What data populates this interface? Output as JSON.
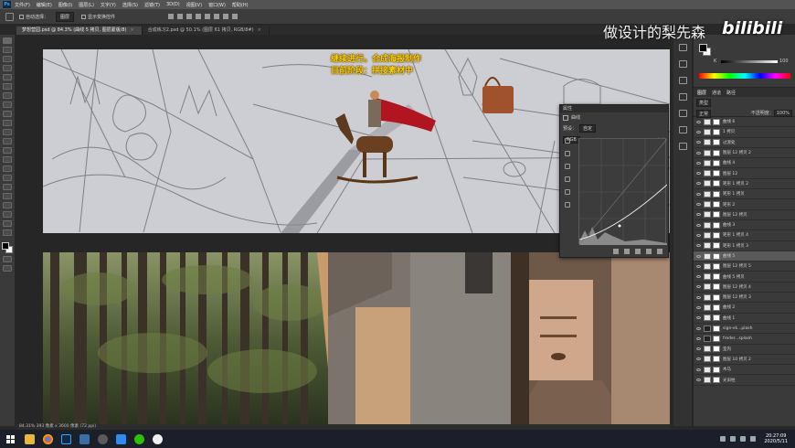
{
  "menubar": {
    "items": [
      "文件(F)",
      "编辑(E)",
      "图像(I)",
      "图层(L)",
      "文字(Y)",
      "选择(S)",
      "滤镜(T)",
      "3D(D)",
      "视图(V)",
      "窗口(W)",
      "帮助(H)"
    ]
  },
  "options": {
    "auto_select_label": "自动选择：",
    "auto_select_value": "图层",
    "transform_label": "显示变换控件"
  },
  "tabs": [
    {
      "label": "梦想营园.psd @ 84.3% (曲线 5 拷贝, 图层蒙版/8)"
    },
    {
      "label": "合成练习2.psd @ 50.1% (图层 61 拷贝, RGB/8#)"
    }
  ],
  "captions": {
    "line1": "继续进行。合成海报制作",
    "line2": "目前阶段：拼接素材中"
  },
  "watermark": {
    "text": "做设计的梨先森",
    "logo": "bilibili"
  },
  "properties": {
    "title": "属性",
    "type": "曲线",
    "preset_label": "预设：",
    "preset_value": "自定",
    "channel_value": "RGB",
    "auto_label": "自动"
  },
  "color_panel": {
    "k_label": "K",
    "k_value": "100"
  },
  "layers": {
    "tabs": [
      "图层",
      "通道",
      "路径"
    ],
    "kind_label": "类型",
    "blend_mode": "正常",
    "opacity_label": "不透明度：",
    "opacity_value": "100%",
    "lock_label": "锁定：",
    "fill_label": "填充：",
    "fill_value": "100%",
    "rows": [
      {
        "name": "曲线 6"
      },
      {
        "name": "1 拷贝"
      },
      {
        "name": "过渡处"
      },
      {
        "name": "图层 12 拷贝 2"
      },
      {
        "name": "曲线 4"
      },
      {
        "name": "图层 12"
      },
      {
        "name": "矩形 1 拷贝 2"
      },
      {
        "name": "矩形 1 拷贝"
      },
      {
        "name": "矩形 2"
      },
      {
        "name": "图层 12 拷贝"
      },
      {
        "name": "曲线 3"
      },
      {
        "name": "矩形 1 拷贝 4"
      },
      {
        "name": "矩形 1 拷贝 3"
      },
      {
        "name": "曲线 5"
      },
      {
        "name": "图层 12 拷贝 5"
      },
      {
        "name": "曲线 5 拷贝"
      },
      {
        "name": "图层 12 拷贝 4"
      },
      {
        "name": "图层 12 拷贝 3"
      },
      {
        "name": "曲线 2"
      },
      {
        "name": "曲线 1"
      },
      {
        "name": "sign-vk...plash"
      },
      {
        "name": "freder...splash"
      },
      {
        "name": "室内"
      },
      {
        "name": "图层 10 拷贝 2"
      },
      {
        "name": "木马"
      },
      {
        "name": "光旧柱"
      }
    ]
  },
  "status": {
    "text": "84.31%   393 像素 x 3600 像素 (72 ppi)"
  },
  "taskbar": {
    "time": "20:27:09",
    "date": "2020/5/11"
  }
}
